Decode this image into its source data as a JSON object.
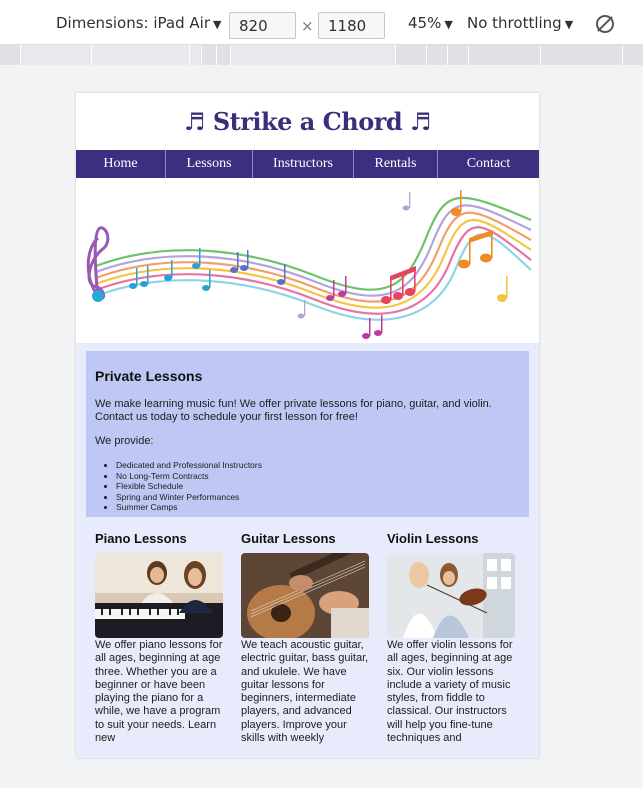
{
  "devtools": {
    "device_label": "Dimensions: iPad Air",
    "width_value": "820",
    "times_symbol": "×",
    "height_value": "1180",
    "zoom_label": "45%",
    "throttle_label": "No throttling",
    "caret": "▼"
  },
  "site": {
    "title": "♬ Strike a Chord ♬",
    "nav": [
      "Home",
      "Lessons",
      "Instructors",
      "Rentals",
      "Contact"
    ]
  },
  "private_lessons": {
    "heading": "Private Lessons",
    "intro": "We make learning music fun! We offer private lessons for piano, guitar, and violin. Contact us today to schedule your first lesson for free!",
    "provide_label": "We provide:",
    "items": [
      "Dedicated and Professional Instructors",
      "No Long-Term Contracts",
      "Flexible Schedule",
      "Spring and Winter Performances",
      "Summer Camps"
    ]
  },
  "lessons": [
    {
      "heading": "Piano Lessons",
      "text": "We offer piano lessons for all ages, beginning at age three. Whether you are a beginner or have been playing the piano for a while, we have a program to suit your needs. Learn new"
    },
    {
      "heading": "Guitar Lessons",
      "text": "We teach acoustic guitar, electric guitar, bass guitar, and ukulele. We have guitar lessons for beginners, intermediate players, and advanced players. Improve your skills with weekly"
    },
    {
      "heading": "Violin Lessons",
      "text": "We offer violin lessons for all ages, beginning at age six. Our violin lessons include a variety of music styles, from fiddle to classical. Our instructors will help you fine-tune techniques and"
    }
  ],
  "colors": {
    "nav_bg": "#3c2f80",
    "title": "#38317a",
    "content_bg": "#e8ebfc",
    "private_bg": "#bfc8f4"
  }
}
